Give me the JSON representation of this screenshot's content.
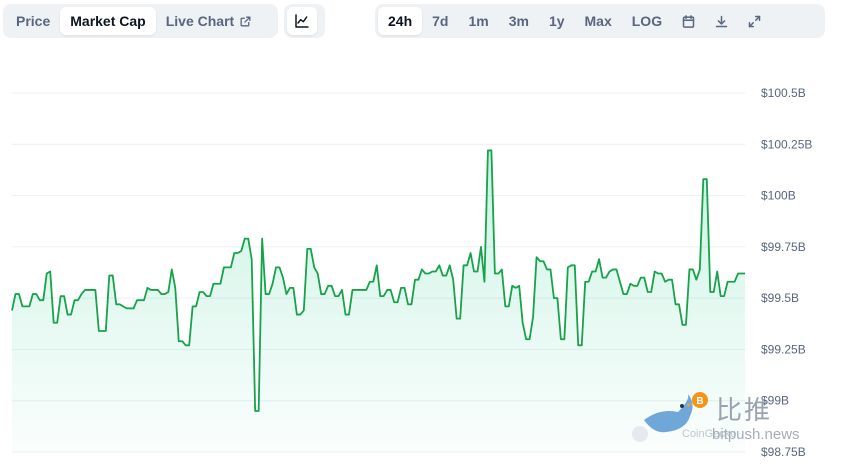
{
  "toolbar": {
    "view_tabs": [
      {
        "label": "Price",
        "active": false
      },
      {
        "label": "Market Cap",
        "active": true
      },
      {
        "label": "Live Chart",
        "active": false
      }
    ],
    "chart_type_icon": "line-chart-icon",
    "range_tabs": [
      {
        "label": "24h",
        "active": true
      },
      {
        "label": "7d",
        "active": false
      },
      {
        "label": "1m",
        "active": false
      },
      {
        "label": "3m",
        "active": false
      },
      {
        "label": "1y",
        "active": false
      },
      {
        "label": "Max",
        "active": false
      },
      {
        "label": "LOG",
        "active": false
      }
    ],
    "tool_icons": [
      "calendar-icon",
      "download-icon",
      "fullscreen-icon"
    ]
  },
  "watermark": {
    "cn_text": "比推",
    "url": "bitpush.news",
    "bot_text": "CoinGecko"
  },
  "colors": {
    "line": "#16a34a",
    "fill_top": "#16c784",
    "grid": "#eceff3",
    "axis_text": "#58667e",
    "accent_orange": "#f7931a"
  },
  "chart_data": {
    "type": "area",
    "title": "",
    "xlabel": "",
    "ylabel": "",
    "ylim": [
      98.75,
      100.5
    ],
    "y_unit": "B USD",
    "y_ticks": [
      98.75,
      99.0,
      99.25,
      99.5,
      99.75,
      100.0,
      100.25,
      100.5
    ],
    "y_tick_labels": [
      "$98.75B",
      "$99B",
      "$99.25B",
      "$99.5B",
      "$99.75B",
      "$100B",
      "$100.25B",
      "$100.5B"
    ],
    "grid": true,
    "series": [
      {
        "values": [
          99.44,
          99.52,
          99.52,
          99.46,
          99.46,
          99.46,
          99.52,
          99.52,
          99.49,
          99.49,
          99.62,
          99.63,
          99.38,
          99.38,
          99.51,
          99.51,
          99.42,
          99.42,
          99.49,
          99.49,
          99.52,
          99.54,
          99.54,
          99.54,
          99.54,
          99.34,
          99.34,
          99.34,
          99.61,
          99.61,
          99.47,
          99.47,
          99.46,
          99.45,
          99.45,
          99.45,
          99.49,
          99.49,
          99.49,
          99.55,
          99.54,
          99.54,
          99.54,
          99.52,
          99.52,
          99.53,
          99.64,
          99.55,
          99.29,
          99.29,
          99.27,
          99.27,
          99.46,
          99.46,
          99.53,
          99.53,
          99.51,
          99.51,
          99.57,
          99.57,
          99.57,
          99.65,
          99.65,
          99.65,
          99.72,
          99.72,
          99.73,
          99.79,
          99.79,
          99.69,
          98.95,
          98.95,
          99.79,
          99.52,
          99.52,
          99.57,
          99.65,
          99.65,
          99.6,
          99.52,
          99.55,
          99.55,
          99.42,
          99.42,
          99.44,
          99.74,
          99.74,
          99.65,
          99.62,
          99.52,
          99.52,
          99.56,
          99.56,
          99.51,
          99.51,
          99.54,
          99.42,
          99.42,
          99.54,
          99.54,
          99.54,
          99.54,
          99.54,
          99.58,
          99.58,
          99.66,
          99.51,
          99.51,
          99.54,
          99.54,
          99.48,
          99.48,
          99.55,
          99.55,
          99.47,
          99.47,
          99.59,
          99.59,
          99.64,
          99.62,
          99.62,
          99.63,
          99.63,
          99.66,
          99.61,
          99.61,
          99.66,
          99.59,
          99.4,
          99.4,
          99.66,
          99.66,
          99.72,
          99.63,
          99.63,
          99.75,
          99.58,
          100.22,
          100.22,
          99.62,
          99.62,
          99.64,
          99.46,
          99.46,
          99.56,
          99.55,
          99.56,
          99.38,
          99.3,
          99.3,
          99.41,
          99.7,
          99.68,
          99.68,
          99.64,
          99.64,
          99.5,
          99.5,
          99.3,
          99.3,
          99.65,
          99.66,
          99.66,
          99.27,
          99.27,
          99.58,
          99.58,
          99.63,
          99.63,
          99.69,
          99.6,
          99.6,
          99.63,
          99.64,
          99.64,
          99.58,
          99.52,
          99.52,
          99.57,
          99.56,
          99.56,
          99.6,
          99.6,
          99.53,
          99.53,
          99.63,
          99.62,
          99.62,
          99.58,
          99.59,
          99.59,
          99.47,
          99.47,
          99.37,
          99.37,
          99.64,
          99.64,
          99.59,
          99.64,
          100.08,
          100.08,
          99.53,
          99.53,
          99.63,
          99.51,
          99.51,
          99.58,
          99.58,
          99.58,
          99.62,
          99.62,
          99.62
        ]
      }
    ]
  }
}
